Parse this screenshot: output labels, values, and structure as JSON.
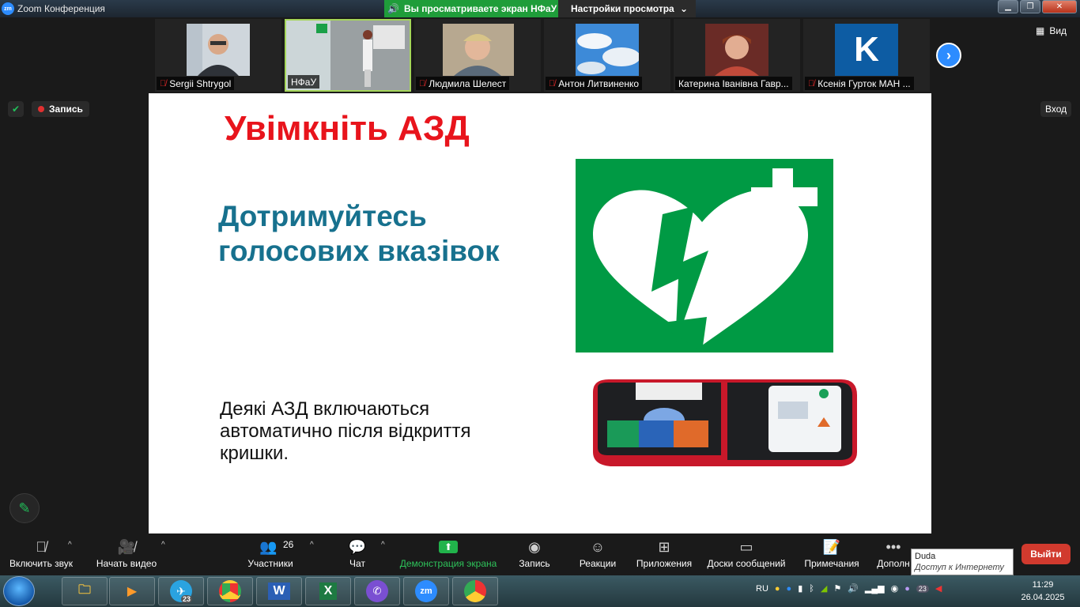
{
  "window": {
    "title": "Zoom Конференция",
    "logo": "zm",
    "share_banner": "Вы просматриваете экран НФаУ",
    "view_settings": "Настройки просмотра"
  },
  "participants": [
    {
      "name": "Sergii Shtrygol",
      "muted": true
    },
    {
      "name": "НФаУ",
      "muted": false
    },
    {
      "name": "Людмила Шелест",
      "muted": true
    },
    {
      "name": "Антон Литвиненко",
      "muted": true
    },
    {
      "name": "Катерина Іванівна Гавр...",
      "muted": false
    },
    {
      "name": "Ксенія Гурток МАН ...",
      "muted": true,
      "avatar_letter": "K"
    }
  ],
  "top_right": {
    "view": "Вид",
    "login": "Вход"
  },
  "recording": {
    "label": "Запись"
  },
  "slide": {
    "title": "Увімкніть АЗД",
    "subtitle": "Дотримуйтесь голосових вказівок",
    "body": "Деякі АЗД включаються автоматично після відкриття кришки."
  },
  "toolbar": {
    "audio": "Включить звук",
    "video": "Начать видео",
    "participants": "Участники",
    "participants_count": "26",
    "chat": "Чат",
    "share": "Демонстрация экрана",
    "record": "Запись",
    "reactions": "Реакции",
    "apps": "Приложения",
    "whiteboards": "Доски сообщений",
    "notes": "Примечания",
    "more": "Дополн",
    "leave": "Выйти"
  },
  "tooltip": {
    "name": "Duda",
    "status": "Доступ к Интернету"
  },
  "taskbar": {
    "telegram_badge": "23",
    "word": "W",
    "zoom": "zm",
    "tray_lang": "RU",
    "tray_badge": "23",
    "time": "11:29",
    "date": "26.04.2025"
  },
  "colors": {
    "slide_title": "#e8141c",
    "slide_subtitle": "#17718e",
    "aed_green": "#009a44",
    "share_green": "#1f9d3a",
    "leave_red": "#d13a2e",
    "zoom_blue": "#2d8cff"
  }
}
